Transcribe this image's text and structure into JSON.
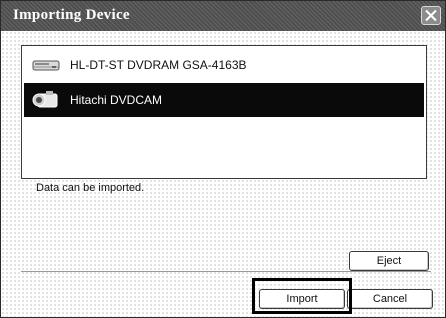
{
  "window": {
    "title": "Importing Device"
  },
  "devices": [
    {
      "label": "HL-DT-ST DVDRAM GSA-4163B",
      "icon": "optical-drive-icon",
      "selected": false
    },
    {
      "label": "Hitachi DVDCAM",
      "icon": "camcorder-icon",
      "selected": true
    }
  ],
  "status": {
    "message": "Data can be imported."
  },
  "buttons": {
    "eject": "Eject",
    "import": "Import",
    "cancel": "Cancel"
  },
  "colors": {
    "titlebar": "#4e4e4e",
    "selection": "#0a0a0a",
    "highlight": "#000000"
  }
}
